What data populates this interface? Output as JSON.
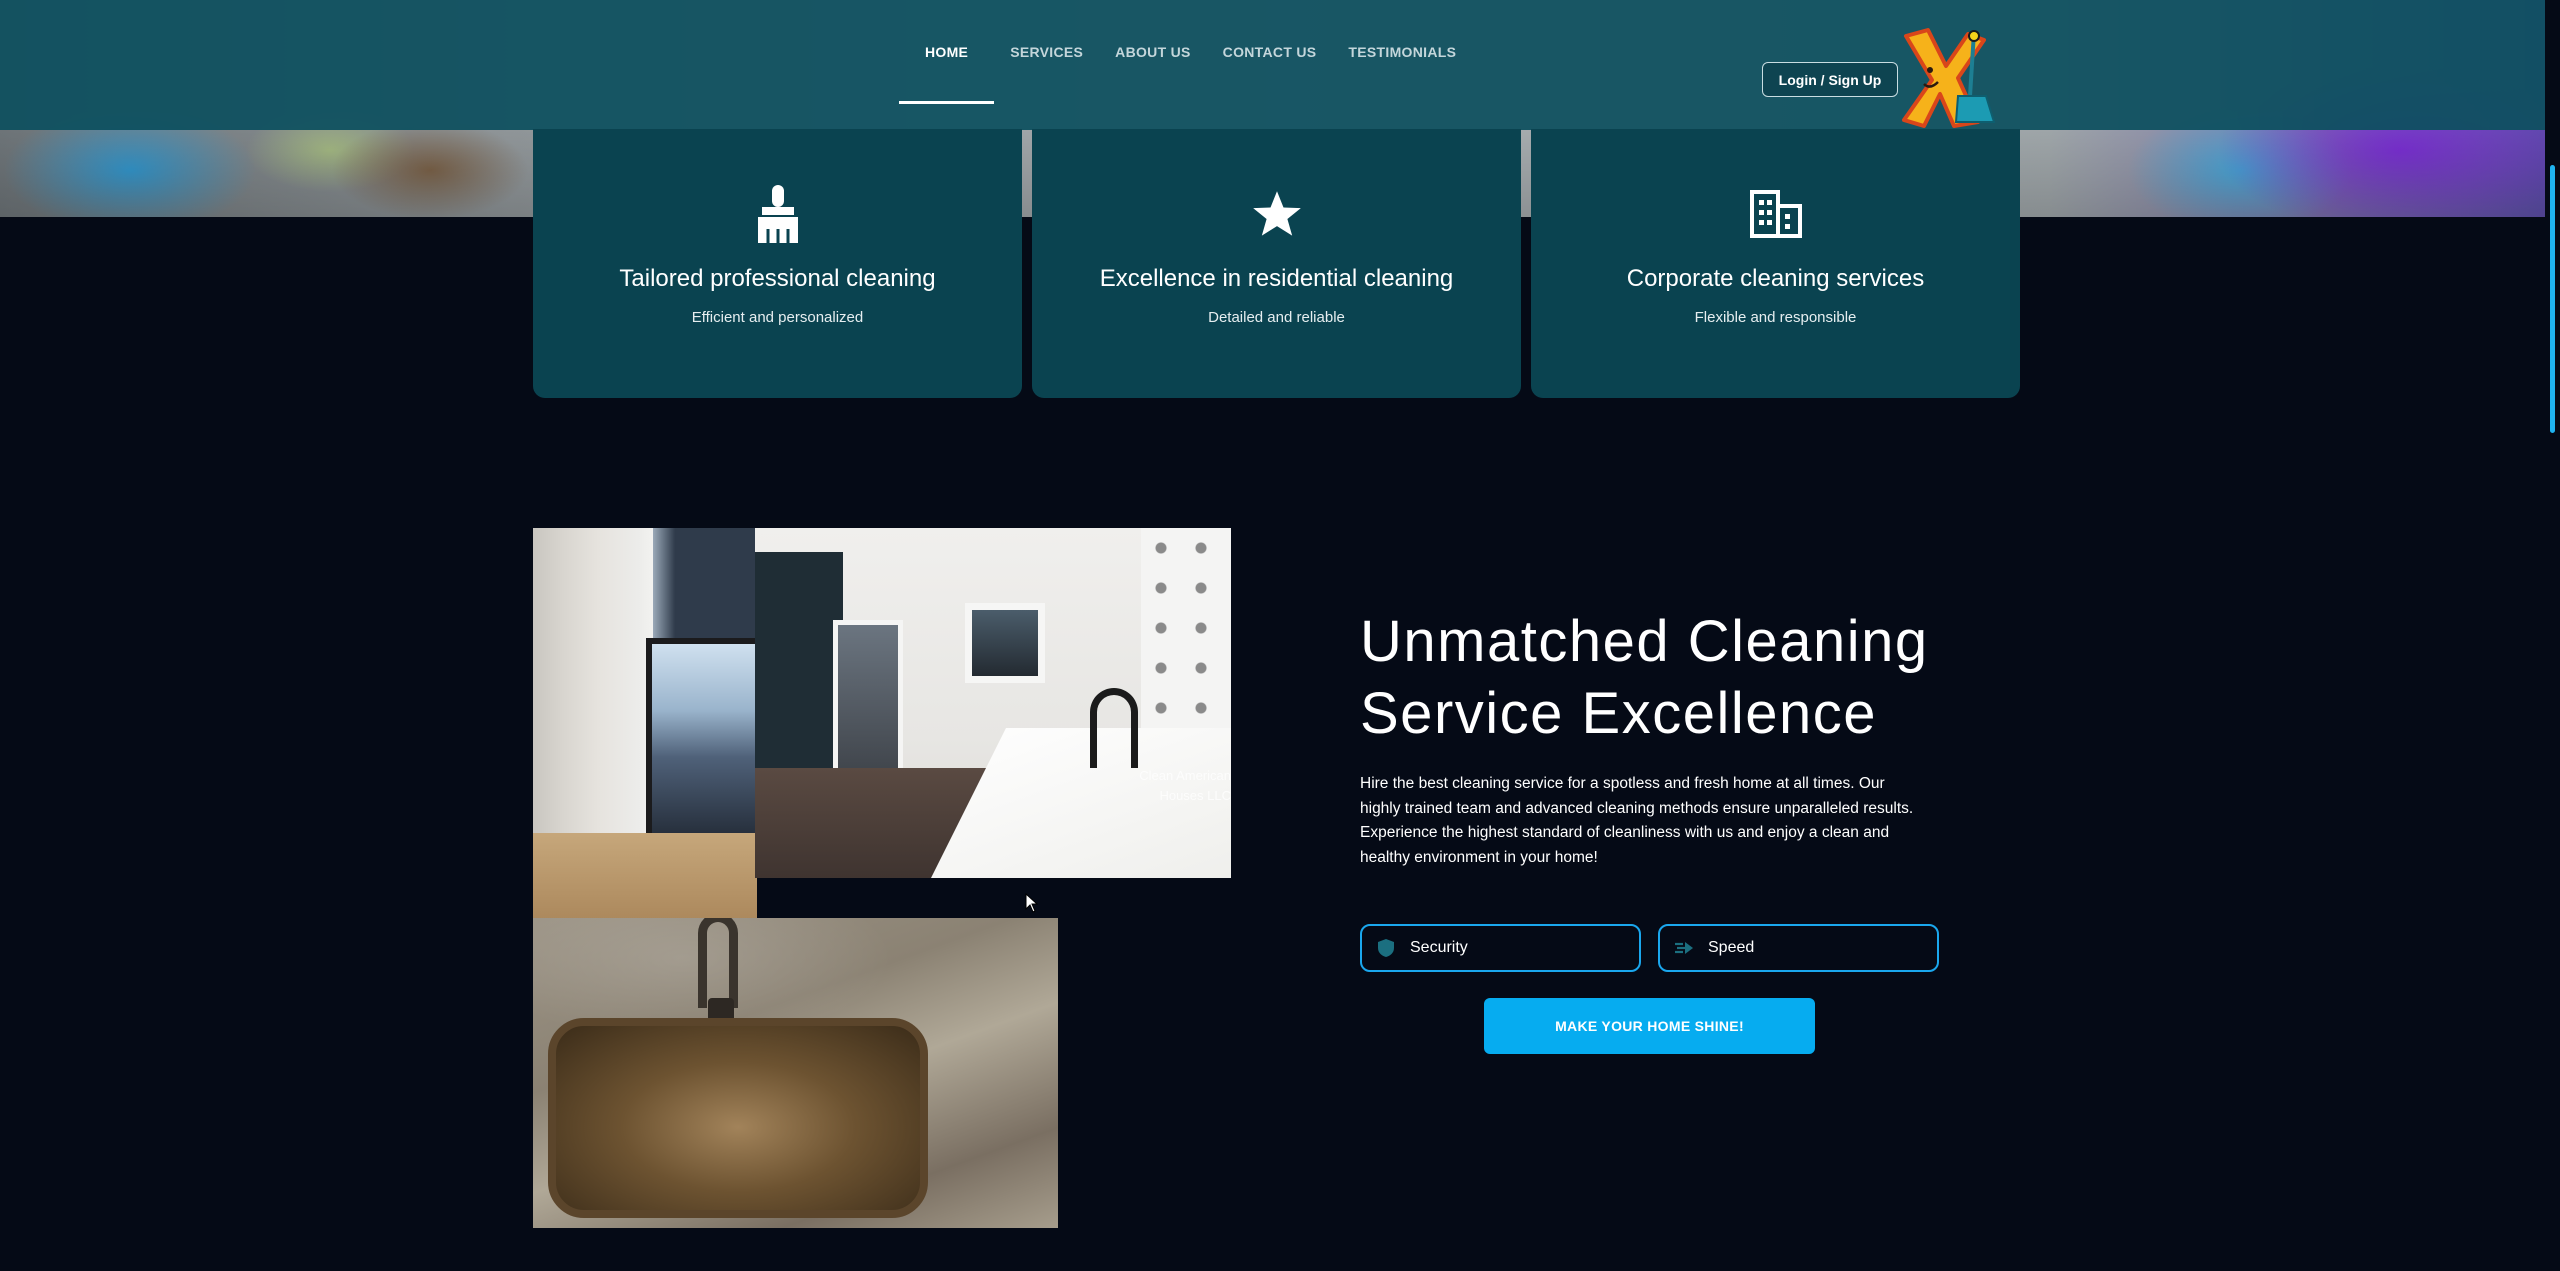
{
  "nav": {
    "items": [
      {
        "label": "HOME",
        "active": true
      },
      {
        "label": "SERVICES",
        "active": false
      },
      {
        "label": "ABOUT US",
        "active": false
      },
      {
        "label": "CONTACT US",
        "active": false
      },
      {
        "label": "TESTIMONIALS",
        "active": false
      }
    ],
    "login_label": "Login / Sign Up",
    "logo_icon": "mascot-logo-icon"
  },
  "cards": [
    {
      "icon": "broom-icon",
      "title": "Tailored professional cleaning",
      "subtitle": "Efficient and personalized"
    },
    {
      "icon": "star-icon",
      "title": "Excellence in residential cleaning",
      "subtitle": "Detailed and reliable"
    },
    {
      "icon": "building-icon",
      "title": "Corporate cleaning services",
      "subtitle": "Flexible and responsible"
    }
  ],
  "gallery": {
    "watermark": "Clean American Houses LLC"
  },
  "feature": {
    "heading": "Unmatched Cleaning Service Excellence",
    "description": "Hire the best cleaning service for a spotless and fresh home at all times. Our highly trained team and advanced cleaning methods ensure unparalleled results. Experience the highest standard of cleanliness with us and enjoy a clean and healthy environment in your home!",
    "pills": [
      {
        "icon": "shield-icon",
        "label": "Security"
      },
      {
        "icon": "speed-icon",
        "label": "Speed"
      }
    ],
    "cta_label": "MAKE YOUR HOME SHINE!"
  },
  "colors": {
    "page_bg": "#050a16",
    "header_bg": "#0d505f",
    "card_bg": "#0a4350",
    "accent": "#06acf0"
  }
}
